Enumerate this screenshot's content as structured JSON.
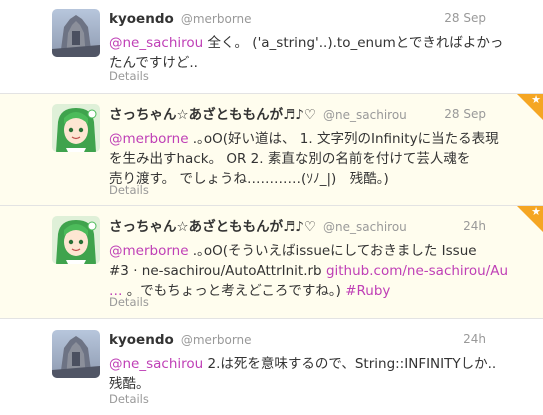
{
  "tweets": [
    {
      "name": "kyoendo",
      "handle": "@merborne",
      "time": "28 Sep",
      "line1_mention": "@ne_sachirou",
      "line1_text": " 全く。 ('a_string'..).to_enumとできればよかっ",
      "line2_text": "たんですけど..",
      "details": "Details"
    },
    {
      "name": "さっちゃん☆あざとももんが♬♪♡",
      "handle": "@ne_sachirou",
      "time": "28 Sep",
      "line1_mention": "@merborne",
      "line1_text": " .｡oO(好い道は、 1. 文字列のInfinityに当たる表現",
      "line2_text": "を生み出すhack。 OR 2. 素直な別の名前を付けて芸人魂を",
      "line3_text": "売り渡す。 でしょうね…………(ｿﾉ_|)　残酷。)",
      "details": "Details",
      "favorited_star": "★"
    },
    {
      "name": "さっちゃん☆あざとももんが♬♪♡",
      "handle": "@ne_sachirou",
      "time": "24h",
      "line1_mention": "@merborne",
      "line1_text": " .｡oO(そういえばissueにしておきました Issue",
      "line2_text": "#3 · ne-sachirou/AutoAttrInit.rb ",
      "line2_link": "github.com/ne-sachirou/Au",
      "line3_link": "…",
      "line3_text": " 。でもちょっと考えどころですね。) ",
      "line3_hashtag": "#Ruby",
      "details": "Details",
      "favorited_star": "★"
    },
    {
      "name": "kyoendo",
      "handle": "@merborne",
      "time": "24h",
      "line1_mention": "@ne_sachirou",
      "line1_text": " 2.は死を意味するので、String::INFINITYしか..",
      "line2_text": "残酷。",
      "details": "Details"
    }
  ]
}
